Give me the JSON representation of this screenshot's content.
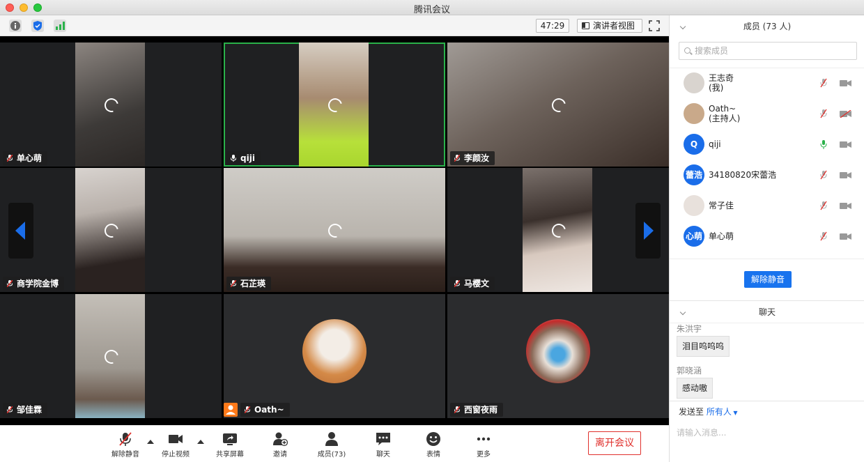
{
  "window": {
    "title": "腾讯会议"
  },
  "toolbar": {
    "timer": "47:29",
    "speaker_view_label": "演讲者视图",
    "icons": [
      "info-icon",
      "shield-icon",
      "signal-icon",
      "fullscreen-icon"
    ]
  },
  "tiles": [
    {
      "name": "单心萌",
      "muted": true
    },
    {
      "name": "qiji",
      "muted": false,
      "active": true
    },
    {
      "name": "李颜汝",
      "muted": true
    },
    {
      "name": "商学院金博",
      "muted": true
    },
    {
      "name": "石芷瑛",
      "muted": true
    },
    {
      "name": "马樱文",
      "muted": true
    },
    {
      "name": "邹佳霖",
      "muted": true
    },
    {
      "name": "Oath~",
      "muted": true,
      "host": true
    },
    {
      "name": "西窗夜雨",
      "muted": true
    }
  ],
  "bottom": {
    "unmute": "解除静音",
    "stop_video": "停止视频",
    "share": "共享屏幕",
    "invite": "邀请",
    "members": "成员(73)",
    "chat": "聊天",
    "emoji": "表情",
    "more": "更多",
    "leave": "离开会议"
  },
  "members_panel": {
    "header": "成员 (73 人)",
    "search_placeholder": "搜索成员",
    "unmute_all": "解除静音",
    "people": [
      {
        "name": "王志奇",
        "sub": "(我)",
        "initials": "",
        "color": "#d9d4cf",
        "mic": "muted",
        "cam": "on"
      },
      {
        "name": "Oath~",
        "sub": "(主持人)",
        "initials": "",
        "color": "#c9a98a",
        "mic": "muted",
        "cam": "off"
      },
      {
        "name": "qiji",
        "sub": "",
        "initials": "Q",
        "color": "#1a6de9",
        "mic": "on",
        "cam": "on"
      },
      {
        "name": "34180820宋蕾浩",
        "sub": "",
        "initials": "蕾浩",
        "color": "#1a6de9",
        "mic": "muted",
        "cam": "on"
      },
      {
        "name": "常子佳",
        "sub": "",
        "initials": "",
        "color": "#e8e1dc",
        "mic": "muted",
        "cam": "on"
      },
      {
        "name": "单心萌",
        "sub": "",
        "initials": "心萌",
        "color": "#1a6de9",
        "mic": "muted",
        "cam": "on"
      }
    ]
  },
  "chat_panel": {
    "header": "聊天",
    "messages": [
      {
        "sender": "朱洪宇",
        "text": "泪目呜呜呜"
      },
      {
        "sender": "郭晓涵",
        "text": "感动嗷"
      }
    ],
    "send_to_label": "发送至",
    "send_to_target": "所有人",
    "input_placeholder": "请输入消息..."
  }
}
